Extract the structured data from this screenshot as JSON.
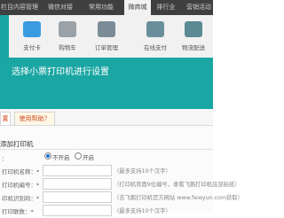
{
  "top_tabs": [
    "栏目内容管理",
    "微信对接",
    "常用功能",
    "微商城",
    "排行业",
    "营销活动"
  ],
  "menu": [
    {
      "label": "",
      "icon": "blank-icon",
      "color": "#1aa6a3"
    },
    {
      "label": "支付卡",
      "icon": "card-icon",
      "color": "#3a9be0"
    },
    {
      "label": "购物车",
      "icon": "cart-icon",
      "color": "#9aa2a8"
    },
    {
      "label": "订单管理",
      "icon": "order-icon",
      "color": "#7b8c96"
    },
    {
      "label": "在线支付",
      "icon": "pay-icon",
      "color": "#6a8f9a"
    },
    {
      "label": "物流配送",
      "icon": "shipping-icon",
      "color": "#5a8a93"
    }
  ],
  "overlay_text": "选择小票打印机进行设置",
  "tabs2": [
    "置",
    "使用帮助？"
  ],
  "form": {
    "title": "添加打印机",
    "rows": [
      {
        "label": "：",
        "options": [
          "不开启",
          "开启"
        ]
      },
      {
        "label": "打印机名称：*",
        "hint": "（最多支持10个汉字）"
      },
      {
        "label": "打印机编号：*",
        "hint": "（打印机背面9位编号，查看飞鹅打印机底部贴纸）"
      },
      {
        "label": "印机识别码：*",
        "hint": "（去飞鹅打印机官方网站 www.feieyun.com获取）"
      },
      {
        "label": "打印联数：*",
        "hint": "（最多支持10个汉字）"
      }
    ]
  }
}
